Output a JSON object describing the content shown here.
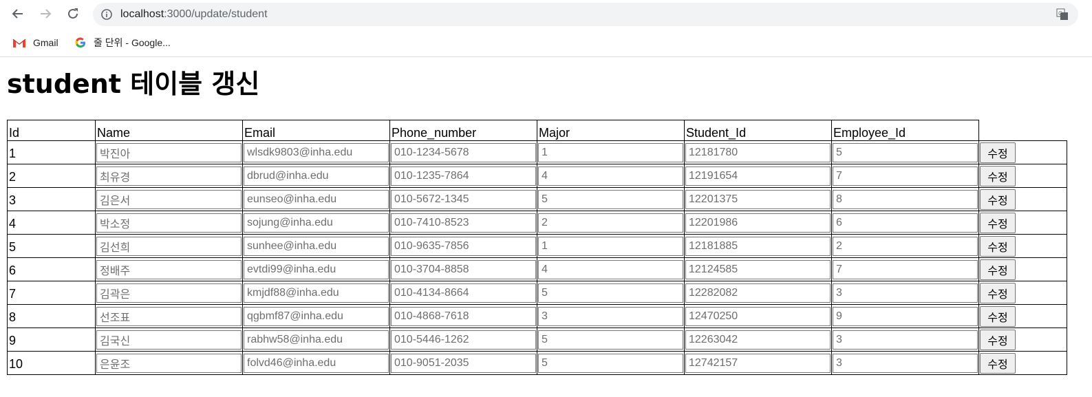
{
  "browser": {
    "url_host": "localhost",
    "url_path": ":3000/update/student",
    "bookmarks": [
      {
        "label": "Gmail",
        "icon": "gmail-icon"
      },
      {
        "label": "줄 단위 - Google...",
        "icon": "google-icon"
      }
    ]
  },
  "page": {
    "title": "student 테이블 갱신",
    "columns": [
      "Id",
      "Name",
      "Email",
      "Phone_number",
      "Major",
      "Student_Id",
      "Employee_Id"
    ],
    "button_label": "수정",
    "rows": [
      {
        "id": "1",
        "name": "박진아",
        "email": "wlsdk9803@inha.edu",
        "phone": "010-1234-5678",
        "major": "1",
        "student_id": "12181780",
        "employee_id": "5"
      },
      {
        "id": "2",
        "name": "최유경",
        "email": "dbrud@inha.edu",
        "phone": "010-1235-7864",
        "major": "4",
        "student_id": "12191654",
        "employee_id": "7"
      },
      {
        "id": "3",
        "name": "김은서",
        "email": "eunseo@inha.edu",
        "phone": "010-5672-1345",
        "major": "5",
        "student_id": "12201375",
        "employee_id": "8"
      },
      {
        "id": "4",
        "name": "박소정",
        "email": "sojung@inha.edu",
        "phone": "010-7410-8523",
        "major": "2",
        "student_id": "12201986",
        "employee_id": "6"
      },
      {
        "id": "5",
        "name": "김선희",
        "email": "sunhee@inha.edu",
        "phone": "010-9635-7856",
        "major": "1",
        "student_id": "12181885",
        "employee_id": "2"
      },
      {
        "id": "6",
        "name": "정배주",
        "email": "evtdi99@inha.edu",
        "phone": "010-3704-8858",
        "major": "4",
        "student_id": "12124585",
        "employee_id": "7"
      },
      {
        "id": "7",
        "name": "김곽은",
        "email": "kmjdf88@inha.edu",
        "phone": "010-4134-8664",
        "major": "5",
        "student_id": "12282082",
        "employee_id": "3"
      },
      {
        "id": "8",
        "name": "선조표",
        "email": "qgbmf87@inha.edu",
        "phone": "010-4868-7618",
        "major": "3",
        "student_id": "12470250",
        "employee_id": "9"
      },
      {
        "id": "9",
        "name": "김국신",
        "email": "rabhw58@inha.edu",
        "phone": "010-5446-1262",
        "major": "5",
        "student_id": "12263042",
        "employee_id": "3"
      },
      {
        "id": "10",
        "name": "은윤조",
        "email": "folvd46@inha.edu",
        "phone": "010-9051-2035",
        "major": "5",
        "student_id": "12742157",
        "employee_id": "3"
      }
    ]
  }
}
